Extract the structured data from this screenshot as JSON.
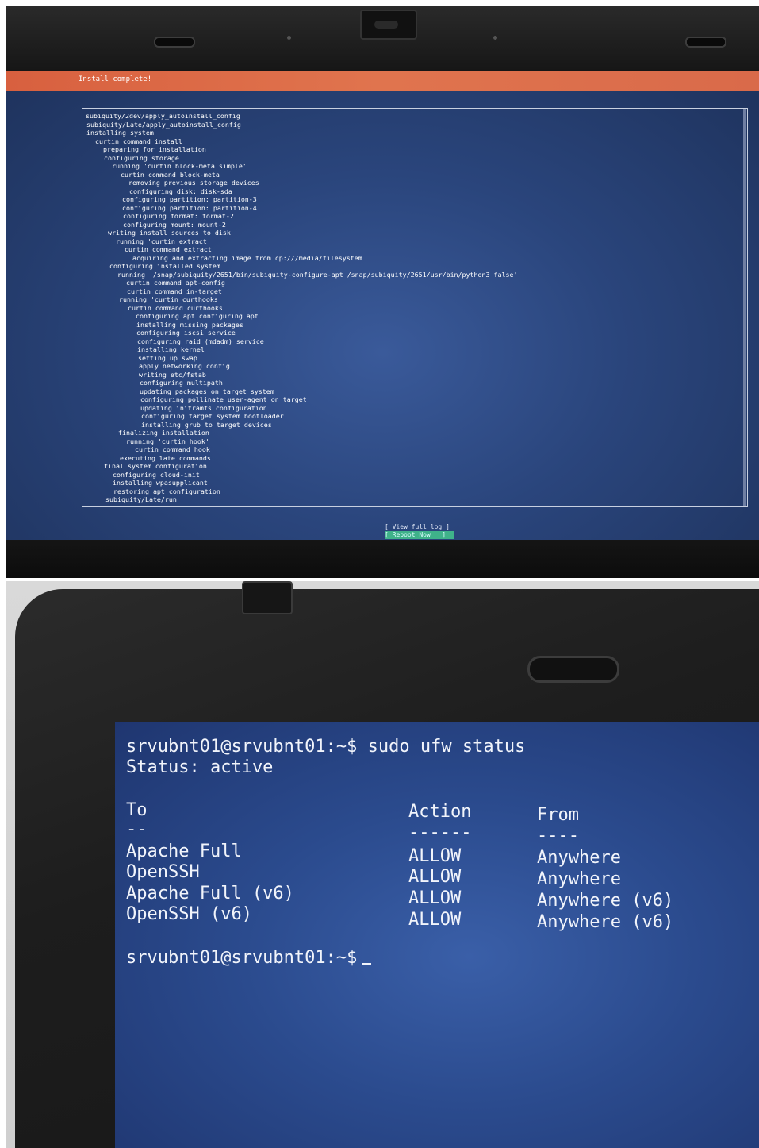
{
  "photo1": {
    "header_title": "Install complete!",
    "log_lines": [
      "subiquity/2dev/apply_autoinstall_config",
      "subiquity/Late/apply_autoinstall_config",
      "installing system",
      "  curtin command install",
      "    preparing for installation",
      "    configuring storage",
      "      running 'curtin block-meta simple'",
      "        curtin command block-meta",
      "          removing previous storage devices",
      "          configuring disk: disk-sda",
      "        configuring partition: partition-3",
      "        configuring partition: partition-4",
      "        configuring format: format-2",
      "        configuring mount: mount-2",
      "    writing install sources to disk",
      "      running 'curtin extract'",
      "        curtin command extract",
      "          acquiring and extracting image from cp:///media/filesystem",
      "    configuring installed system",
      "      running '/snap/subiquity/2651/bin/subiquity-configure-apt /snap/subiquity/2651/usr/bin/python3 false'",
      "        curtin command apt-config",
      "        curtin command in-target",
      "      running 'curtin curthooks'",
      "        curtin command curthooks",
      "          configuring apt configuring apt",
      "          installing missing packages",
      "          configuring iscsi service",
      "          configuring raid (mdadm) service",
      "          installing kernel",
      "          setting up swap",
      "          apply networking config",
      "          writing etc/fstab",
      "          configuring multipath",
      "          updating packages on target system",
      "          configuring pollinate user-agent on target",
      "          updating initramfs configuration",
      "          configuring target system bootloader",
      "          installing grub to target devices",
      "    finalizing installation",
      "      running 'curtin hook'",
      "        curtin command hook",
      "    executing late commands",
      "final system configuration",
      "  configuring cloud-init",
      "  installing wpasupplicant",
      "  restoring apt configuration",
      "subiquity/Late/run"
    ],
    "buttons": {
      "view_log": "[ View full log ]",
      "reboot": "[ Reboot Now   ]"
    }
  },
  "photo2": {
    "prompt": "srvubnt01@srvubnt01:~$",
    "command": "sudo ufw status",
    "status_line": "Status: active",
    "headers": {
      "to": "To",
      "action": "Action",
      "from": "From"
    },
    "separators": {
      "to": "--",
      "action": "------",
      "from": "----"
    },
    "rules": [
      {
        "to": "Apache Full",
        "action": "ALLOW",
        "from": "Anywhere"
      },
      {
        "to": "OpenSSH",
        "action": "ALLOW",
        "from": "Anywhere"
      },
      {
        "to": "Apache Full (v6)",
        "action": "ALLOW",
        "from": "Anywhere (v6)"
      },
      {
        "to": "OpenSSH (v6)",
        "action": "ALLOW",
        "from": "Anywhere (v6)"
      }
    ],
    "final_prompt": "srvubnt01@srvubnt01:~$"
  }
}
